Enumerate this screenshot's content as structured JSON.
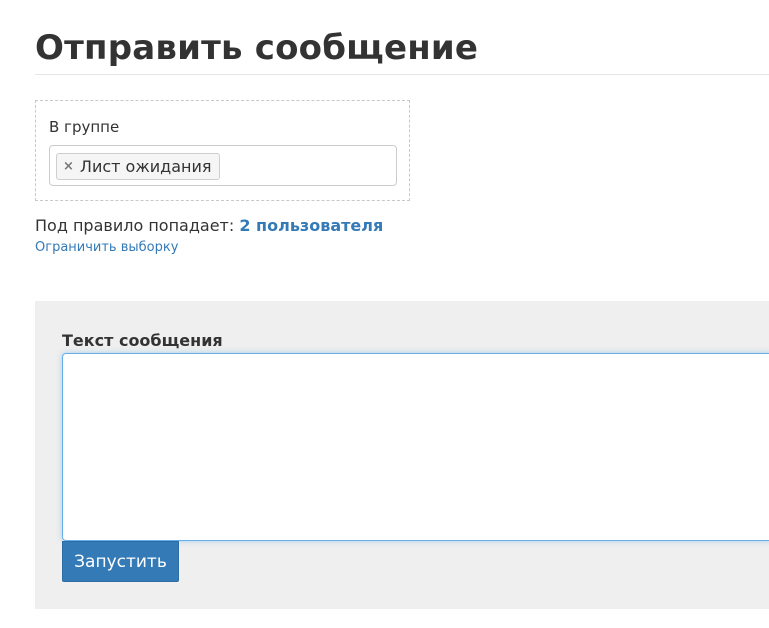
{
  "page": {
    "title": "Отправить сообщение"
  },
  "filter": {
    "label": "В группе",
    "tags": [
      {
        "remove_symbol": "×",
        "label": "Лист ожидания"
      }
    ]
  },
  "match": {
    "prefix": "Под правило попадает: ",
    "count_text": "2 пользователя",
    "restrict_link": "Ограничить выборку"
  },
  "message": {
    "label": "Текст сообщения",
    "value": "",
    "run_button": "Запустить"
  },
  "colors": {
    "accent": "#337ab7",
    "panel_bg": "#efefef",
    "text": "#333333"
  }
}
